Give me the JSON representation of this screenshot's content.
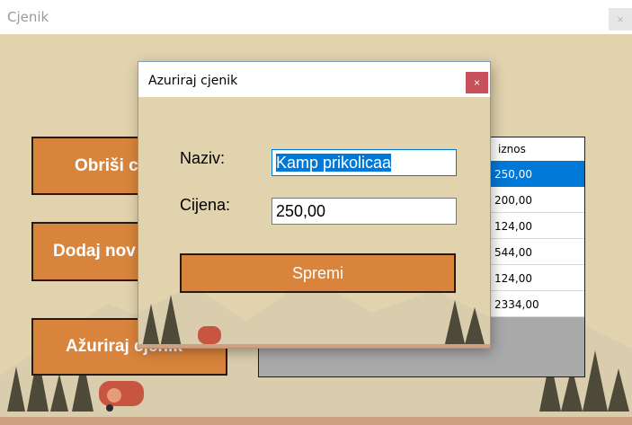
{
  "window": {
    "title": "Cjenik",
    "close_symbol": "×"
  },
  "buttons": {
    "delete_label": "Obriši c",
    "add_label": "Dodaj nov",
    "update_label": "Ažuriraj cjenik"
  },
  "grid": {
    "column_header": "iznos",
    "rows": [
      "250,00",
      "200,00",
      "124,00",
      "544,00",
      "124,00",
      "2334,00"
    ],
    "selected_row": 0
  },
  "dialog": {
    "title": "Azuriraj cjenik",
    "close_symbol": "×",
    "naziv_label": "Naziv:",
    "naziv_value": "Kamp prikolicaa",
    "cijena_label": "Cijena:",
    "cijena_value": "250,00",
    "save_label": "Spremi"
  },
  "colors": {
    "background": "#e1d3ad",
    "button": "#d9843c",
    "selection": "#0078d7",
    "dialog_close": "#c7505a"
  }
}
